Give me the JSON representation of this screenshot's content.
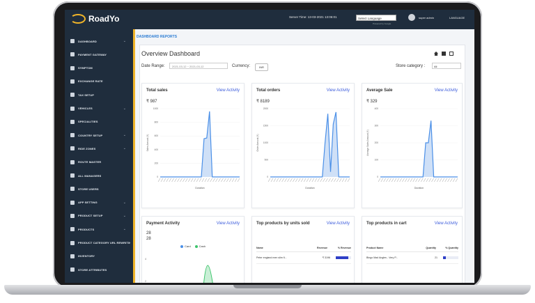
{
  "app": {
    "name": "RoadYo"
  },
  "topbar": {
    "server_time": "Server Time: 13-03-2021 13:06:01",
    "language_select": "Select Language",
    "powered_by": "Powered by Google",
    "user": "super admin",
    "language_link": "LANGUAGE"
  },
  "sidebar": {
    "items": [
      {
        "label": "DASHBOARD",
        "chevron": "⌄"
      },
      {
        "label": "PAYMENT GATEWAY",
        "chevron": ""
      },
      {
        "label": "SYMPTOM",
        "chevron": ""
      },
      {
        "label": "EXCHANGE RATE",
        "chevron": ""
      },
      {
        "label": "TAX SETUP",
        "chevron": ""
      },
      {
        "label": "VEHICLES",
        "chevron": "⌄"
      },
      {
        "label": "SPECIALITIES",
        "chevron": ""
      },
      {
        "label": "COUNTRY SETUP",
        "chevron": "⌄"
      },
      {
        "label": "RIDE ZONES",
        "chevron": "⌄"
      },
      {
        "label": "ROUTE MASTER",
        "chevron": ""
      },
      {
        "label": "ALL MANAGERS",
        "chevron": ""
      },
      {
        "label": "STORE USERS",
        "chevron": ""
      },
      {
        "label": "APP SETTING",
        "chevron": "⌄"
      },
      {
        "label": "PRODUCT SETUP",
        "chevron": "⌄"
      },
      {
        "label": "PRODUCTS",
        "chevron": "⌄"
      },
      {
        "label": "PRODUCT CATEGORY URL REWRITING",
        "chevron": ""
      },
      {
        "label": "INVENTORY",
        "chevron": ""
      },
      {
        "label": "STORE ATTRIBUTES",
        "chevron": ""
      }
    ]
  },
  "breadcrumb": "DASHBOARD REPORTS",
  "page": {
    "title": "Overview Dashboard",
    "date_label": "Date Range:",
    "date_value": "2021-03-12 ~ 2021-03-12",
    "currency_label": "Currency:",
    "currency_value": "INR",
    "store_label": "Store category :",
    "store_value": "All"
  },
  "cards": {
    "total_sales": {
      "title": "Total sales",
      "link": "View Activity",
      "value": "₹ 987"
    },
    "total_orders": {
      "title": "Total orders",
      "link": "View Activity",
      "value": "₹ 8189"
    },
    "average_sale": {
      "title": "Average Sale",
      "link": "View Activity",
      "value": "₹ 329"
    },
    "payment_activity": {
      "title": "Payment Activity",
      "link": "View Activity",
      "value_card": "28",
      "value_cash": "28",
      "legend_card": "Card",
      "legend_cash": "Cash"
    },
    "top_units": {
      "title": "Top products by units sold",
      "link": "View Activity",
      "col_name": "Name",
      "col_revenue": "Revenue",
      "col_pct": "% Revenue",
      "row_name": "Peter england men slim fi...",
      "row_revenue": "₹ 3196",
      "row_pct": 0.8
    },
    "top_cart": {
      "title": "Top products in cart",
      "link": "View Activity",
      "col_name": "Product Name",
      "col_qty": "Quantity",
      "col_pct": "% Quantity",
      "row_name": "Bingo Mad Angles - Very P...",
      "row_qty": "21",
      "row_pct": 0.2
    }
  },
  "chart_data": [
    {
      "type": "area",
      "name": "total_sales",
      "ylabel": "Sales Amount (₹)",
      "xlabel": "Duration",
      "y_ticks": [
        "1000",
        "800",
        "600",
        "400",
        "200",
        "0"
      ],
      "ylim": [
        0,
        1000
      ],
      "values": [
        0,
        0,
        0,
        0,
        0,
        0,
        0,
        0,
        0,
        0,
        0,
        0,
        0,
        0,
        0,
        0,
        560,
        570,
        960,
        0,
        0,
        0,
        0,
        0,
        0,
        0,
        0,
        0,
        0,
        0
      ]
    },
    {
      "type": "area",
      "name": "total_orders",
      "ylabel": "Order Amount (₹)",
      "xlabel": "Duration",
      "y_ticks": [
        "2000",
        "1500",
        "1000",
        "500",
        "0"
      ],
      "ylim": [
        0,
        2000
      ],
      "values": [
        0,
        0,
        0,
        0,
        0,
        0,
        0,
        0,
        0,
        0,
        0,
        0,
        0,
        0,
        0,
        0,
        0,
        0,
        0,
        0,
        1000,
        1850,
        150,
        1550,
        1900,
        0,
        0,
        0,
        0,
        0
      ]
    },
    {
      "type": "area",
      "name": "average_sale",
      "ylabel": "Average Sales Amount (₹)",
      "xlabel": "Duration",
      "y_ticks": [
        "400",
        "300",
        "200",
        "100",
        "0"
      ],
      "ylim": [
        0,
        400
      ],
      "values": [
        0,
        0,
        0,
        0,
        0,
        0,
        0,
        0,
        0,
        0,
        0,
        0,
        0,
        0,
        0,
        0,
        0,
        200,
        200,
        330,
        0,
        0,
        0,
        0,
        0,
        0,
        0,
        0,
        0,
        0
      ]
    }
  ],
  "colors": {
    "sidebar": "#1f2d3d",
    "accent": "#f0b429",
    "link": "#3b5bdb",
    "line": "#4a8fe7",
    "fill": "#cfe0f7",
    "cash": "#3cc46b"
  }
}
